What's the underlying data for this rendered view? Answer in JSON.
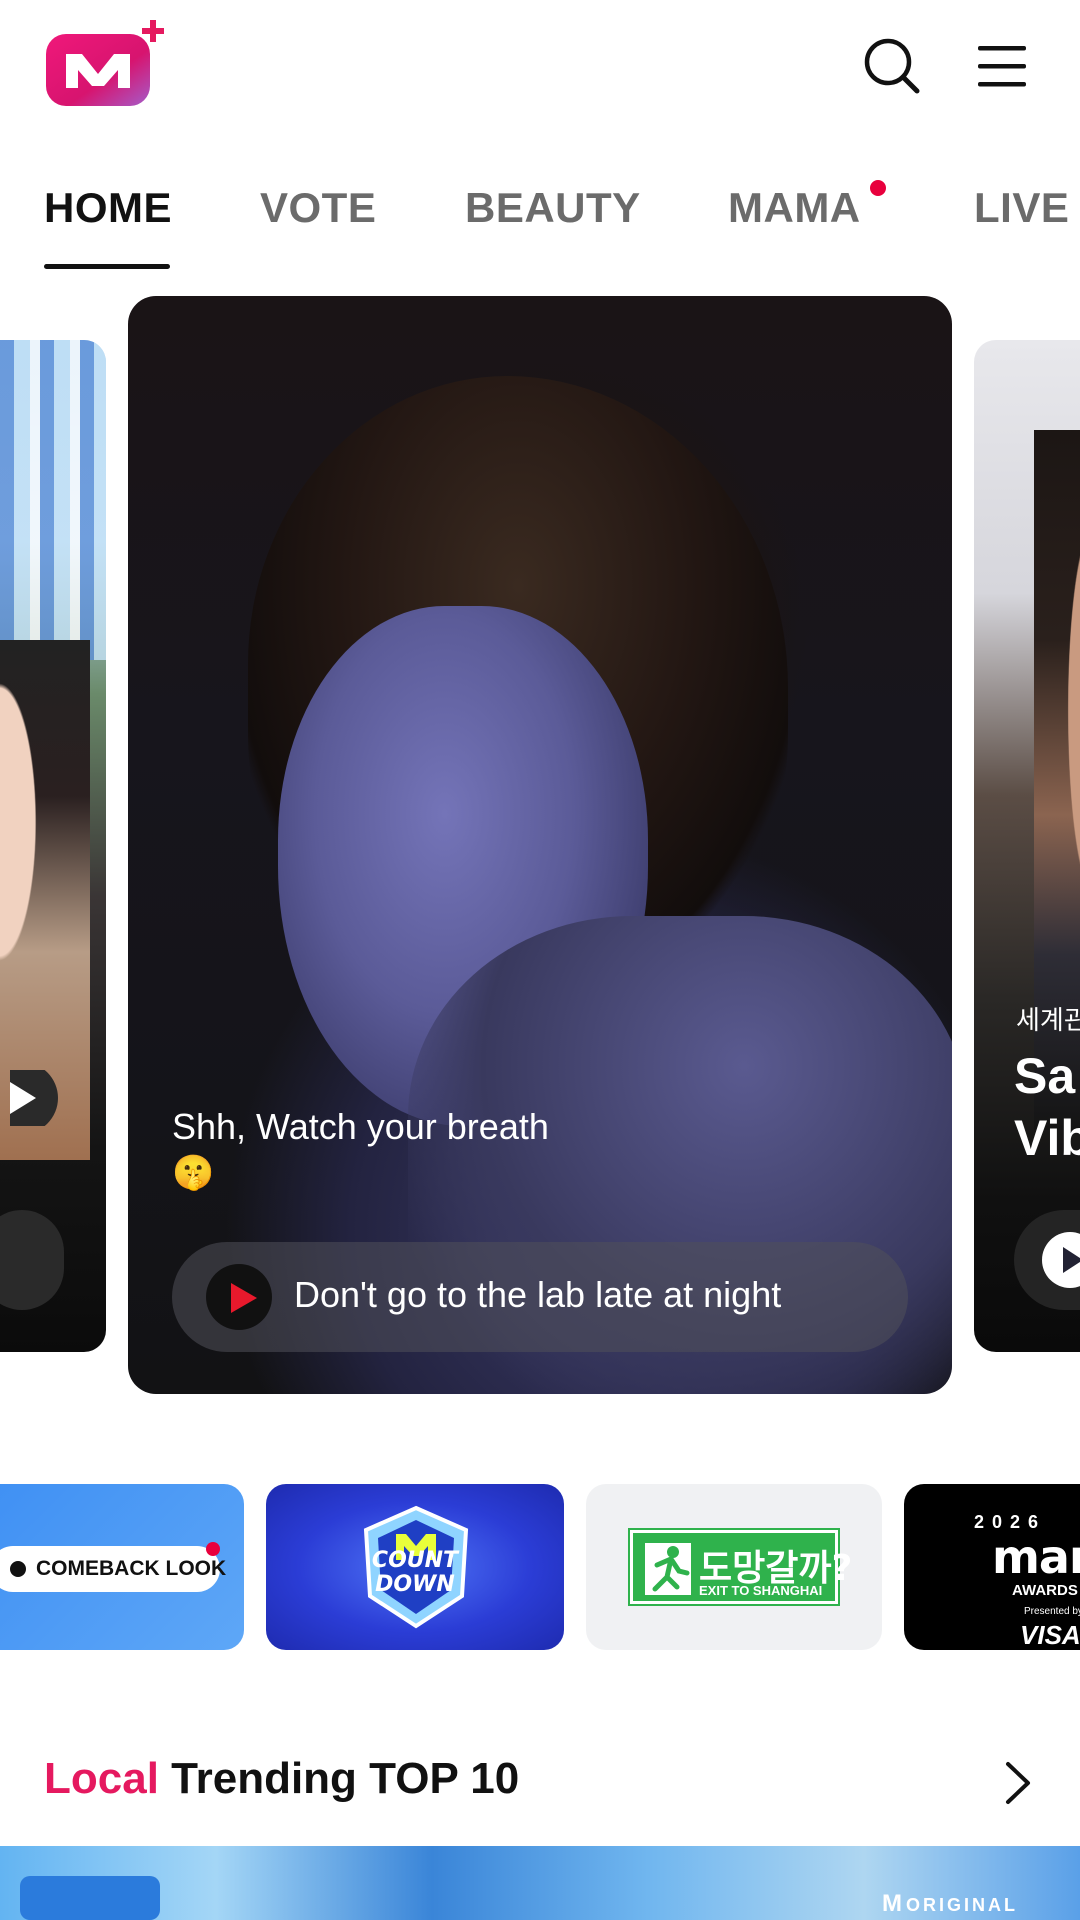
{
  "header": {
    "logo_icon": "mnet-plus-logo",
    "search_icon": "search-icon",
    "menu_icon": "hamburger-menu-icon",
    "brand_color": "#e5195f"
  },
  "tabs": [
    {
      "label": "HOME",
      "active": true
    },
    {
      "label": "VOTE",
      "active": false
    },
    {
      "label": "BEAUTY",
      "active": false
    },
    {
      "label": "MAMA",
      "active": false,
      "has_dot": true
    },
    {
      "label": "LIVE",
      "active": false
    }
  ],
  "carousel": {
    "main": {
      "caption": "Shh, Watch your breath",
      "caption_emoji": "🤫",
      "play_label": "Don't go to the lab late at night"
    },
    "right": {
      "subtitle": "세계관",
      "title_line1": "Sa",
      "title_line2": "Vib"
    }
  },
  "shortcuts": {
    "comeback": "COMEBACK LOOK",
    "countdown_line1": "COUNT",
    "countdown_line2": "DOWN",
    "exit_kr": "도망갈까?",
    "exit_en": "EXIT TO SHANGHAI",
    "mama_year": "2026",
    "mama_logo": "mama",
    "mama_awards": "AWARDS",
    "mama_presented": "Presented by",
    "mama_visa": "VISA"
  },
  "trending": {
    "title_accent": "Local",
    "title_rest": " Trending TOP 10",
    "arrow_icon": "chevron-right-icon",
    "badge_text": "ORIGINAL",
    "badge_logo": "M"
  }
}
